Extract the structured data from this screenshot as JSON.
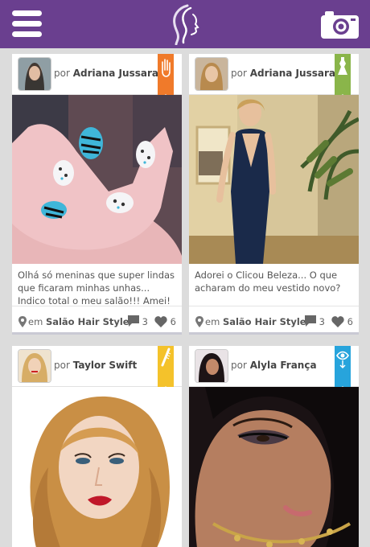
{
  "header": {
    "menu_icon": "hamburger-menu-icon",
    "logo_icon": "woman-silhouette-logo-icon",
    "camera_icon": "camera-icon",
    "bar_color": "#6a3f8f"
  },
  "posts": [
    {
      "by_prefix": "por",
      "author": "Adriana Jussara",
      "ribbon_color": "#f07a2a",
      "ribbon_icon": "hand-icon",
      "caption": "Olhá só meninas que super lindas que ficaram minhas unhas... Indico total o meu salão!!! Amei!",
      "loc_prefix": "em",
      "location": "Salão Hair Style",
      "comments": "3",
      "likes": "6"
    },
    {
      "by_prefix": "por",
      "author": "Adriana Jussara",
      "ribbon_color": "#8ab54a",
      "ribbon_icon": "dress-icon",
      "caption": "Adorei o Clicou Beleza... O que acharam do meu vestido novo?",
      "loc_prefix": "em",
      "location": "Salão Hair Style",
      "comments": "3",
      "likes": "6"
    },
    {
      "by_prefix": "por",
      "author": "Taylor Swift",
      "ribbon_color": "#f4c22b",
      "ribbon_icon": "hair-brush-icon",
      "caption": "",
      "loc_prefix": "",
      "location": "",
      "comments": "",
      "likes": ""
    },
    {
      "by_prefix": "por",
      "author": "Alyla França",
      "ribbon_color": "#27a4dc",
      "ribbon_icon": "eye-makeup-icon",
      "caption": "",
      "loc_prefix": "",
      "location": "",
      "comments": "",
      "likes": ""
    }
  ]
}
